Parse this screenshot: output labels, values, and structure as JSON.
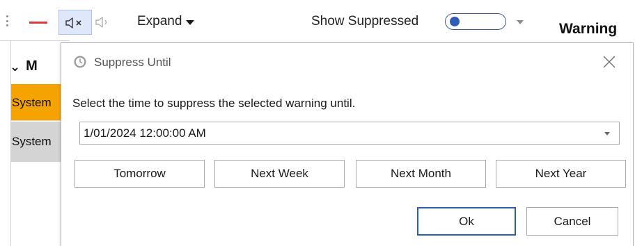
{
  "toolbar": {
    "expand_label": "Expand",
    "show_suppressed_label": "Show Suppressed",
    "show_suppressed_on": false,
    "icons": [
      "grip-icon",
      "remove-icon",
      "mute-icon",
      "sound-icon",
      "chevron-down-icon",
      "dropdown-arrow-icon"
    ],
    "accent_color": "#2f5db6",
    "remove_color": "#d93a3a"
  },
  "warnings_panel": {
    "title": "Warning"
  },
  "grid": {
    "group_header": "M",
    "rows": [
      {
        "label": "System",
        "selected": true,
        "color": "#f5a300"
      },
      {
        "label": "System",
        "selected": false,
        "color": "#d4d4d4"
      }
    ]
  },
  "dialog": {
    "title": "Suppress Until",
    "instruction": "Select the time to suppress the selected warning until.",
    "date_value": "1/01/2024 12:00:00 AM",
    "quick_buttons": [
      "Tomorrow",
      "Next Week",
      "Next Month",
      "Next Year"
    ],
    "ok_label": "Ok",
    "cancel_label": "Cancel",
    "icons": [
      "clock-icon",
      "close-icon"
    ]
  }
}
